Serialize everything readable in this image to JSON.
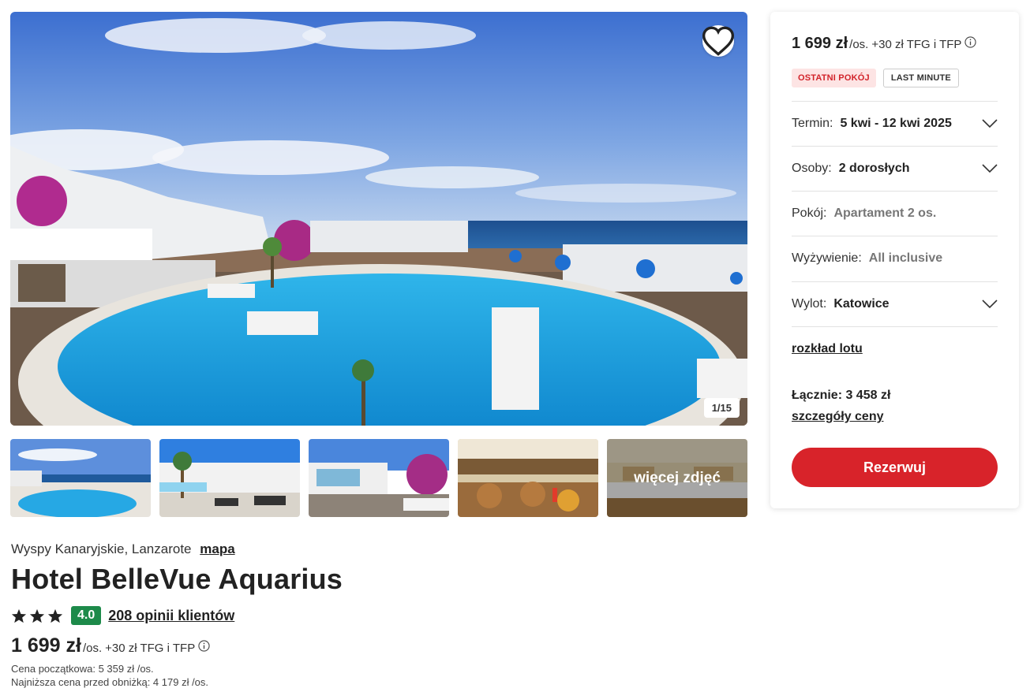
{
  "gallery": {
    "counter": "1/15",
    "more_photos_label": "więcej zdjęć",
    "thumbnails": [
      "pool",
      "terrace",
      "garden",
      "restaurant",
      "buffet"
    ]
  },
  "hotel": {
    "location": "Wyspy Kanaryjskie, Lanzarote",
    "map_link": "mapa",
    "name": "Hotel BelleVue Aquarius",
    "stars": 3,
    "score": "4.0",
    "reviews_link": "208 opinii klientów",
    "price": "1 699 zł",
    "price_unit": "/os.",
    "price_extra": "+30 zł TFG i TFP",
    "original_price": "Cena początkowa: 5 359 zł /os.",
    "lowest_price": "Najniższa cena przed obniżką: 4 179 zł /os."
  },
  "booking": {
    "price": "1 699 zł",
    "price_unit": "/os.",
    "price_extra": "+30 zł TFG i TFP",
    "tags": [
      "OSTATNI POKÓJ",
      "LAST MINUTE"
    ],
    "options": [
      {
        "label": "Termin:",
        "value": "5 kwi - 12 kwi 2025"
      },
      {
        "label": "Osoby:",
        "value": "2 dorosłych"
      },
      {
        "label": "Pokój:",
        "value": "Apartament 2 os."
      },
      {
        "label": "Wyżywienie:",
        "value": "All inclusive"
      },
      {
        "label": "Wylot:",
        "value": "Katowice"
      }
    ],
    "flight_schedule_link": "rozkład lotu",
    "total": "Łącznie: 3 458 zł",
    "price_details_link": "szczegóły ceny",
    "reserve_button": "Rezerwuj"
  },
  "colors": {
    "accent_red": "#d8232a",
    "score_green": "#1d8a4a",
    "tag_red_bg": "#fde4e4"
  }
}
